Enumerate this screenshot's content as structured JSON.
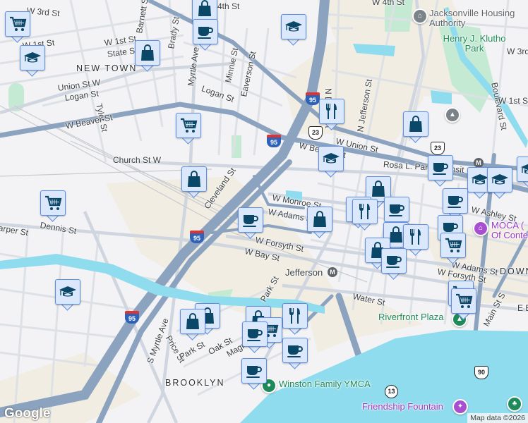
{
  "map": {
    "areas": [
      "NEW TOWN",
      "BROOKLYN",
      "DOWN"
    ],
    "streets": [
      "W 3rd St",
      "4th St",
      "W 4th St",
      "W 1st St",
      "State St",
      "Union St W",
      "Logan St",
      "Tyler St",
      "W Beaver St",
      "Brady St",
      "Myrtle Ave",
      "Minnie St",
      "Eaverson St",
      "Logan St",
      "Church St W",
      "Cleveland St",
      "W Monroe St",
      "W Adams St",
      "W Forsyth St",
      "W Bay St",
      "Dennis St",
      "arper St",
      "S Myrtle Ave",
      "Price St",
      "Park St",
      "Oak St",
      "Magnolia St",
      "Park St",
      "W Union St",
      "W Beaver St",
      "N Davis St",
      "N Jefferson St",
      "Rosa L. Parks Transit",
      "W Ashley St",
      "W Adams St",
      "W Forsyth St",
      "Water St",
      "Main St S",
      "E B",
      "Boulevard St",
      "W 1st St",
      "W 3rd St",
      "Barnett St",
      "W 1st St"
    ],
    "pois": {
      "housing": "Jacksonville Housing Authority",
      "park": "Henry J. Klutho Park",
      "moca": "MOCA (Museum Of Contemporary Art)",
      "riverfront": "Riverfront Plaza",
      "ymca": "Winston Family YMCA",
      "fountain": "Friendship Fountain",
      "jefferson": "Jefferson"
    },
    "moca_line1": "MOCA (",
    "moca_line2": "Of Conte",
    "shields": {
      "i95": "95",
      "us23": "23",
      "us90": "90",
      "sr13": "13"
    },
    "metro_glyph": "M",
    "logo": "Google",
    "attribution": "Map data ©2026"
  },
  "marker_types": [
    "shopping-cart",
    "school",
    "shopping-bag",
    "coffee",
    "restaurant"
  ],
  "colors": {
    "marker_fill": "#dbe7fb",
    "marker_border": "#5e8fe0",
    "marker_icon": "#0b4766",
    "highway": "#8ca3c0",
    "water": "#8fdcee",
    "park": "#bfe8cf"
  }
}
